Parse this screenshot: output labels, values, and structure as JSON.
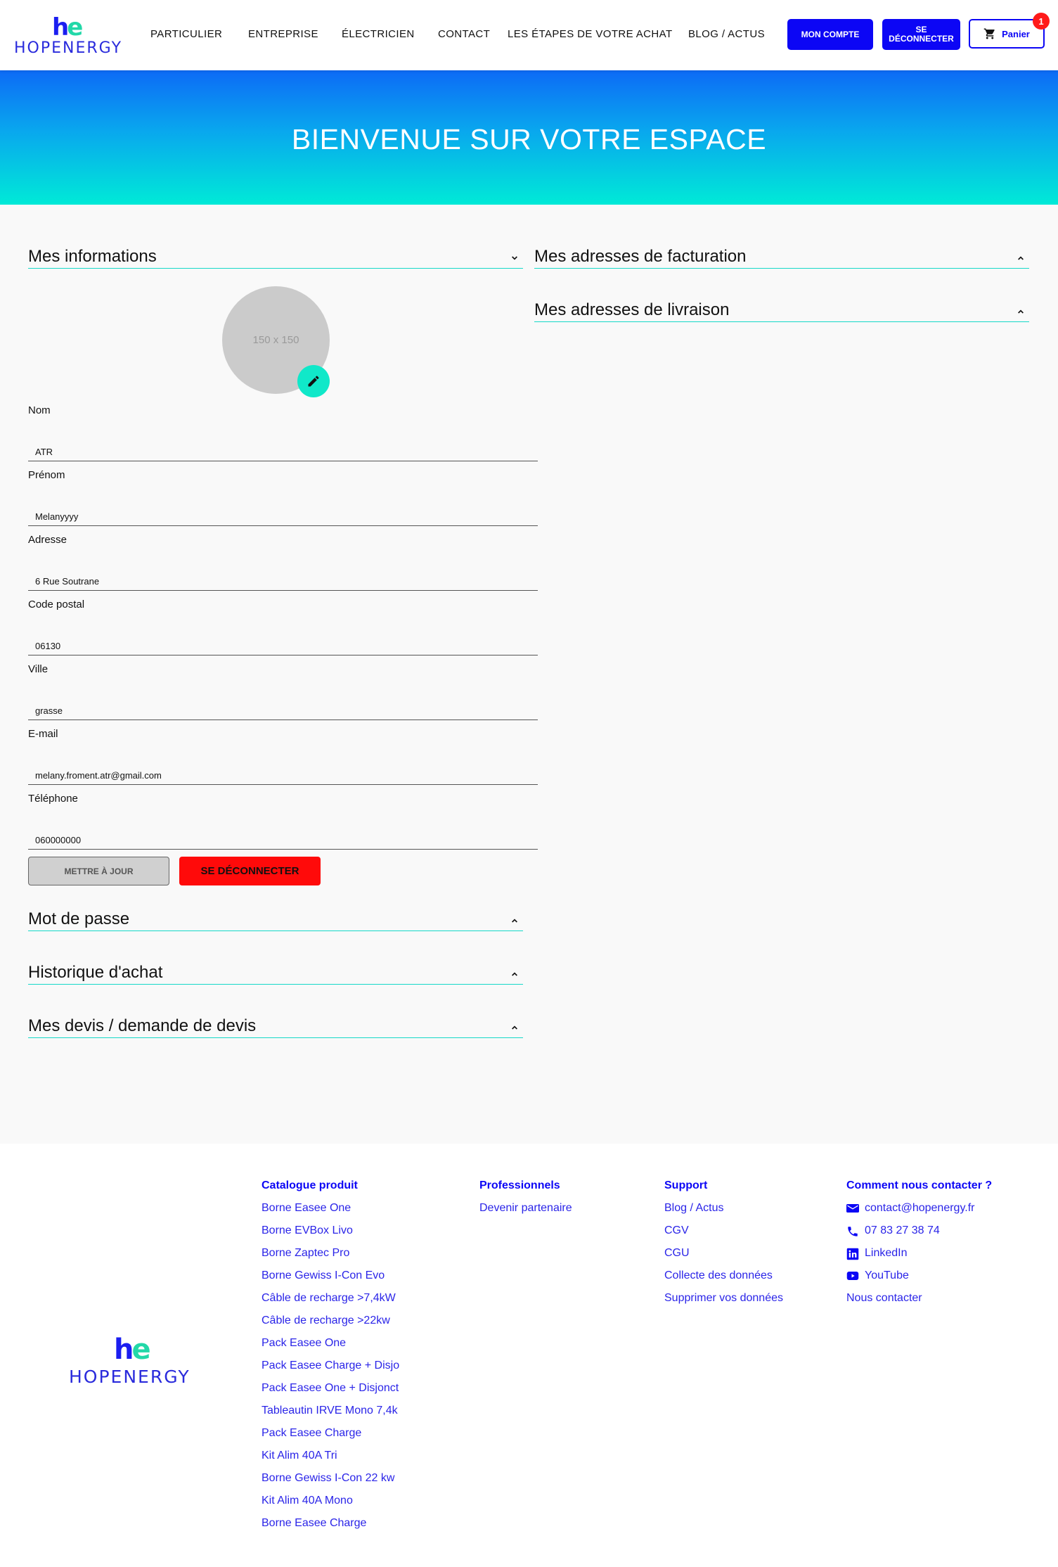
{
  "brand": {
    "mark_h": "h",
    "mark_e": "e",
    "wordmark": "HOPENERGY",
    "colors": {
      "primary": "#0c06f5",
      "accent": "#16d9c8",
      "danger": "#ff0a0a"
    }
  },
  "nav": {
    "items": [
      "PARTICULIER",
      "ENTREPRISE",
      "ÉLECTRICIEN",
      "CONTACT",
      "LES ÉTAPES DE VOTRE ACHAT",
      "BLOG / ACTUS"
    ],
    "account_button": "MON COMPTE",
    "logout_button_line1": "SE",
    "logout_button_line2": "DÉCONNECTER",
    "cart_label": "Panier",
    "cart_count": "1"
  },
  "hero": {
    "title": "BIENVENUE SUR VOTRE ESPACE"
  },
  "sections": {
    "infos": "Mes informations",
    "billing": "Mes adresses de facturation",
    "delivery": "Mes adresses de livraison",
    "password": "Mot de passe",
    "history": "Historique d'achat",
    "quotes": "Mes devis / demande de devis"
  },
  "avatar": {
    "placeholder": "150 x 150",
    "edit_icon": "pencil-icon"
  },
  "form": {
    "fields": [
      {
        "label": "Nom",
        "value": "ATR"
      },
      {
        "label": "Prénom",
        "value": "Melanyyyy"
      },
      {
        "label": "Adresse",
        "value": "6 Rue Soutrane"
      },
      {
        "label": "Code postal",
        "value": "06130"
      },
      {
        "label": "Ville",
        "value": "grasse"
      },
      {
        "label": "E-mail",
        "value": "melany.froment.atr@gmail.com"
      },
      {
        "label": "Téléphone",
        "value": "060000000"
      }
    ],
    "update_button": "METTRE À JOUR",
    "logout_button": "SE DÉCONNECTER"
  },
  "footer": {
    "catalogue": {
      "heading": "Catalogue produit",
      "links": [
        "Borne Easee One",
        "Borne EVBox Livo",
        "Borne Zaptec Pro",
        "Borne Gewiss I-Con Evo",
        "Câble de recharge >7,4kW",
        "Câble de recharge >22kw",
        "Pack Easee One",
        "Pack Easee Charge + Disjo",
        "Pack Easee One + Disjonct",
        "Tableautin IRVE Mono 7,4k",
        "Pack Easee Charge",
        "Kit Alim 40A Tri",
        "Borne Gewiss I-Con 22 kw",
        "Kit Alim 40A Mono",
        "Borne Easee Charge"
      ]
    },
    "pro": {
      "heading": "Professionnels",
      "links": [
        "Devenir partenaire"
      ]
    },
    "support": {
      "heading": "Support",
      "links": [
        "Blog / Actus",
        "CGV",
        "CGU",
        "Collecte des données",
        "Supprimer vos données"
      ]
    },
    "contact": {
      "heading": "Comment nous contacter ?",
      "email": "contact@hopenergy.fr",
      "phone": "07 83 27 38 74",
      "linkedin": "LinkedIn",
      "youtube": "YouTube",
      "contact_link": "Nous contacter"
    }
  }
}
